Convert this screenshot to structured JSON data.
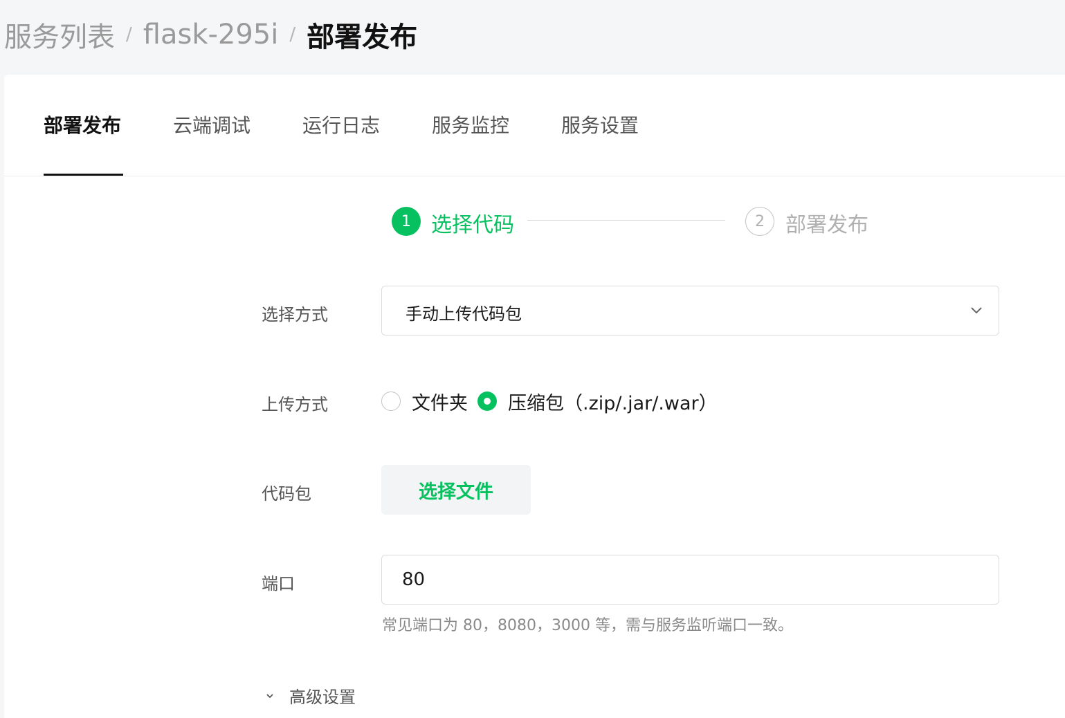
{
  "breadcrumb": {
    "items": [
      "服务列表",
      "flask-295i"
    ],
    "separator": "/",
    "current": "部署发布"
  },
  "tabs": [
    "部署发布",
    "云端调试",
    "运行日志",
    "服务监控",
    "服务设置"
  ],
  "active_tab": "部署发布",
  "steps": [
    {
      "number": "1",
      "label": "选择代码",
      "state": "active"
    },
    {
      "number": "2",
      "label": "部署发布",
      "state": "pending"
    }
  ],
  "form": {
    "method": {
      "label": "选择方式",
      "value": "手动上传代码包",
      "icon": "chevron-down-icon"
    },
    "upload_type": {
      "label": "上传方式",
      "options": [
        {
          "label": "文件夹",
          "selected": false
        },
        {
          "label": "压缩包（.zip/.jar/.war）",
          "selected": true
        }
      ]
    },
    "package": {
      "label": "代码包",
      "button": "选择文件"
    },
    "port": {
      "label": "端口",
      "value": "80",
      "hint": "常见端口为 80，8080，3000 等，需与服务监听端口一致。"
    },
    "advanced": {
      "label": "高级设置",
      "icon": "chevron-down-icon"
    }
  },
  "colors": {
    "accent": "#07c160",
    "page_bg": "#f5f6f7",
    "card_bg": "#ffffff",
    "muted_text": "#8a8a8a"
  }
}
